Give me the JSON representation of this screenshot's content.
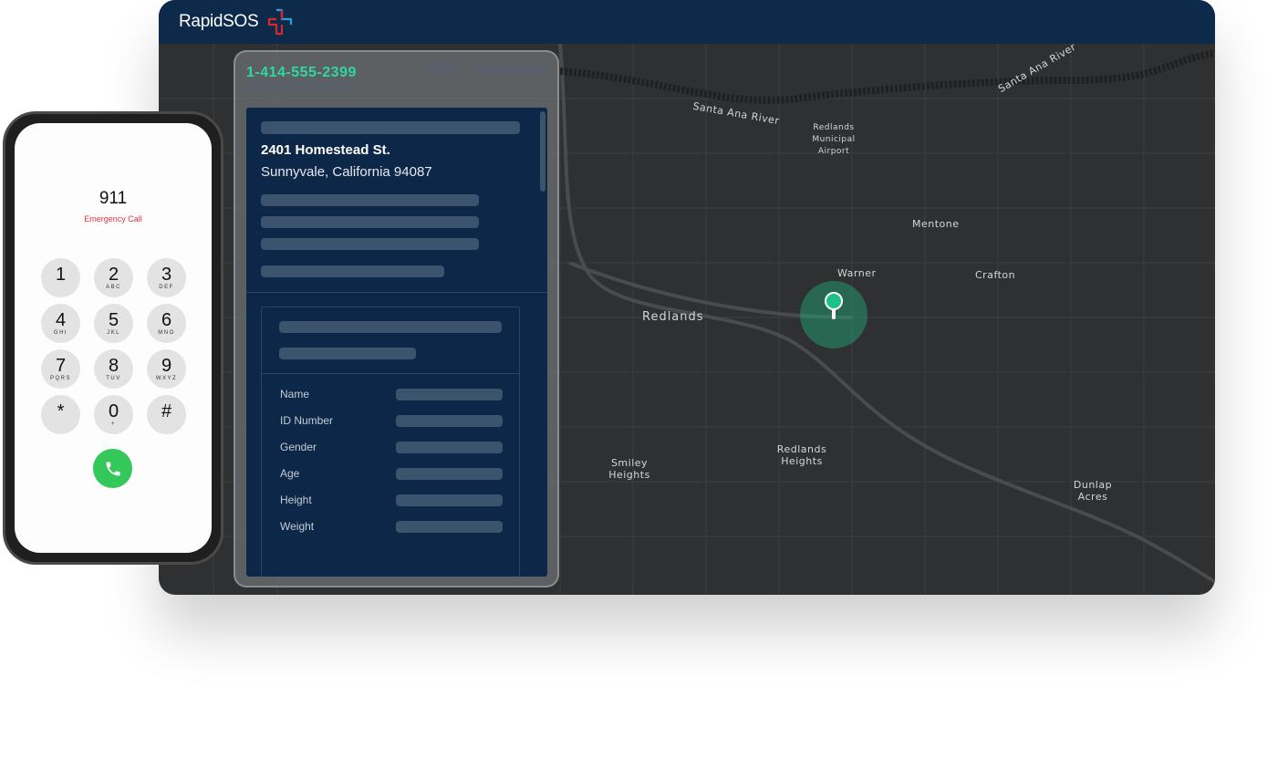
{
  "app": {
    "brand": "RapidSOS",
    "accent": "#2fd8a0",
    "header_color": "#0e2a4b"
  },
  "panel": {
    "caller_number": "1-414-555-2399",
    "address_line1": "2401 Homestead St.",
    "address_line2": "Sunnyvale, California 94087",
    "fields": [
      {
        "label": "Name"
      },
      {
        "label": "ID Number"
      },
      {
        "label": "Gender"
      },
      {
        "label": "Age"
      },
      {
        "label": "Height"
      },
      {
        "label": "Weight"
      }
    ]
  },
  "map": {
    "labels": [
      "Santa Ana River",
      "Santa Ana River",
      "Redlands Municipal Airport",
      "Mentone",
      "Warner",
      "Crafton",
      "Redlands",
      "Smiley Heights",
      "Redlands Heights",
      "Dunlap Acres"
    ],
    "pin_icon": "location-pin-icon"
  },
  "phone": {
    "number": "911",
    "status": "Emergency Call",
    "status_color": "#e5333f",
    "keys": [
      {
        "d": "1",
        "s": ""
      },
      {
        "d": "2",
        "s": "ABC"
      },
      {
        "d": "3",
        "s": "DEF"
      },
      {
        "d": "4",
        "s": "GHI"
      },
      {
        "d": "5",
        "s": "JKL"
      },
      {
        "d": "6",
        "s": "MNO"
      },
      {
        "d": "7",
        "s": "PQRS"
      },
      {
        "d": "8",
        "s": "TUV"
      },
      {
        "d": "9",
        "s": "WXYZ"
      },
      {
        "d": "*",
        "s": ""
      },
      {
        "d": "0",
        "s": "+"
      },
      {
        "d": "#",
        "s": ""
      }
    ],
    "call_icon": "phone-icon"
  }
}
